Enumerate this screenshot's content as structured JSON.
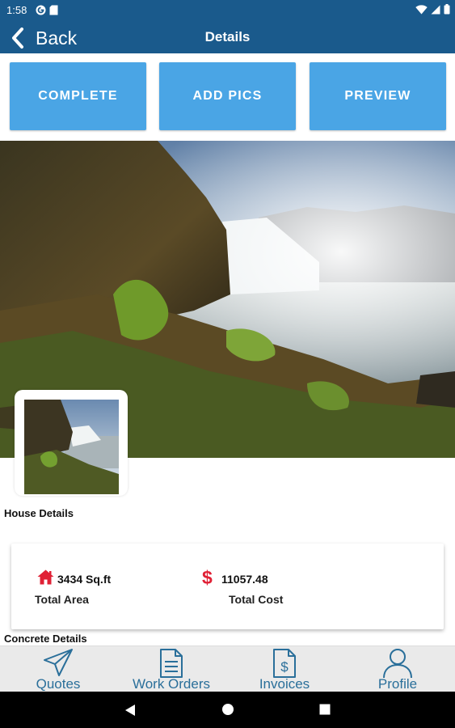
{
  "status_bar": {
    "time": "1:58",
    "left_icons": [
      "g-circle-icon",
      "sd-card-icon"
    ],
    "right_icons": [
      "wifi-icon",
      "signal-icon",
      "battery-icon"
    ]
  },
  "app_bar": {
    "back_label": "Back",
    "title": "Details"
  },
  "actions": {
    "complete": "COMPLETE",
    "add_pics": "ADD PICS",
    "preview": "PREVIEW"
  },
  "sections": {
    "house_details": "House Details",
    "concrete_details": "Concrete Details"
  },
  "stats": {
    "area_value": "3434 Sq.ft",
    "area_label": "Total Area",
    "cost_value": "11057.48",
    "cost_label": "Total Cost",
    "cost_symbol": "$"
  },
  "bottom_nav": {
    "items": [
      {
        "label": "Quotes",
        "icon": "paper-plane-icon"
      },
      {
        "label": "Work Orders",
        "icon": "document-icon"
      },
      {
        "label": "Invoices",
        "icon": "invoice-dollar-icon"
      },
      {
        "label": "Profile",
        "icon": "user-icon"
      }
    ]
  },
  "system_nav": [
    "back-triangle-icon",
    "home-circle-icon",
    "recents-square-icon"
  ],
  "colors": {
    "header_bg": "#1a5a8c",
    "action_button": "#4aa5e5",
    "nav_label": "#2a6f9a",
    "accent_red": "#e02035"
  }
}
